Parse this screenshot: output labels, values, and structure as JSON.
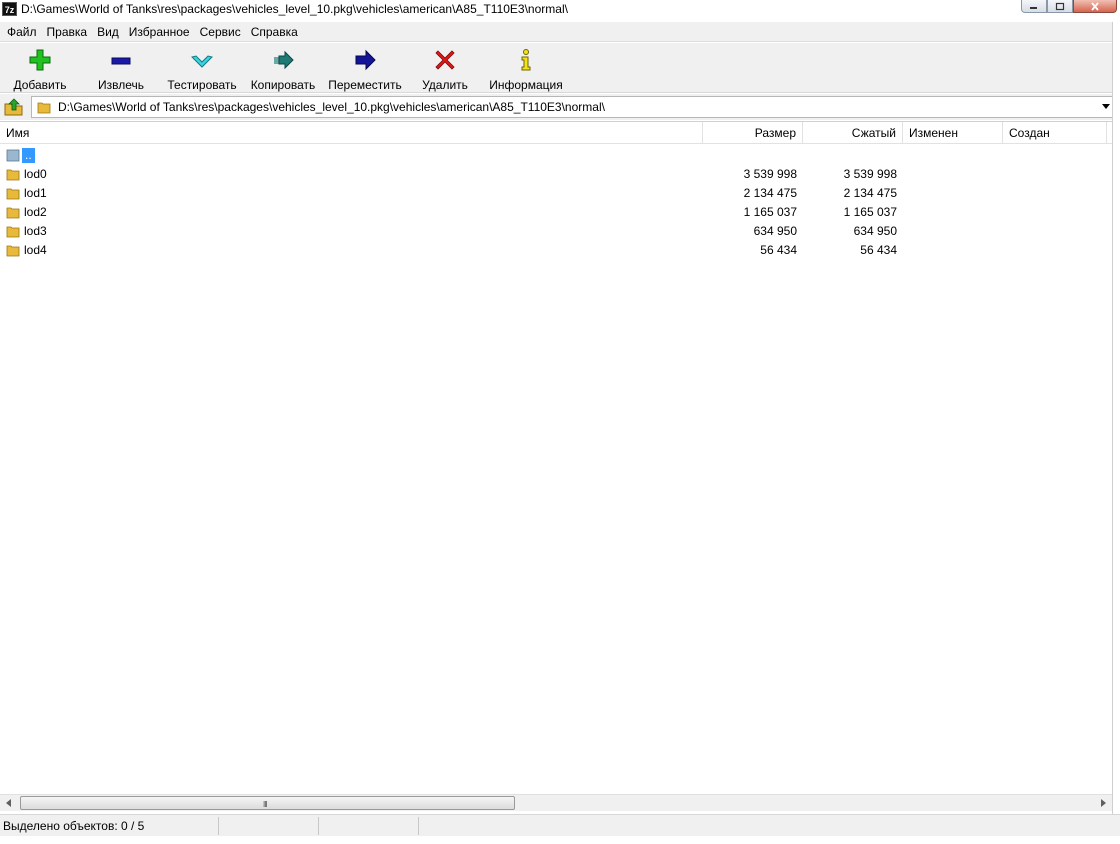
{
  "window": {
    "title": "D:\\Games\\World of Tanks\\res\\packages\\vehicles_level_10.pkg\\vehicles\\american\\A85_T110E3\\normal\\",
    "app_icon_text": "7z"
  },
  "menu": [
    "Файл",
    "Правка",
    "Вид",
    "Избранное",
    "Сервис",
    "Справка"
  ],
  "toolbar": {
    "add": "Добавить",
    "extract": "Извлечь",
    "test": "Тестировать",
    "copy": "Копировать",
    "move": "Переместить",
    "delete": "Удалить",
    "info": "Информация"
  },
  "address": {
    "path": "D:\\Games\\World of Tanks\\res\\packages\\vehicles_level_10.pkg\\vehicles\\american\\A85_T110E3\\normal\\"
  },
  "columns": {
    "name": "Имя",
    "size": "Размер",
    "packed": "Сжатый",
    "modified": "Изменен",
    "created": "Создан"
  },
  "rows": [
    {
      "name": "..",
      "size": "",
      "packed": ""
    },
    {
      "name": "lod0",
      "size": "3 539 998",
      "packed": "3 539 998"
    },
    {
      "name": "lod1",
      "size": "2 134 475",
      "packed": "2 134 475"
    },
    {
      "name": "lod2",
      "size": "1 165 037",
      "packed": "1 165 037"
    },
    {
      "name": "lod3",
      "size": "634 950",
      "packed": "634 950"
    },
    {
      "name": "lod4",
      "size": "56 434",
      "packed": "56 434"
    }
  ],
  "status": {
    "selected": "Выделено объектов: 0 / 5"
  },
  "scrollbar": {
    "grip": "III"
  },
  "colors": {
    "selection": "#3399ff",
    "folder": "#e8b93a"
  }
}
